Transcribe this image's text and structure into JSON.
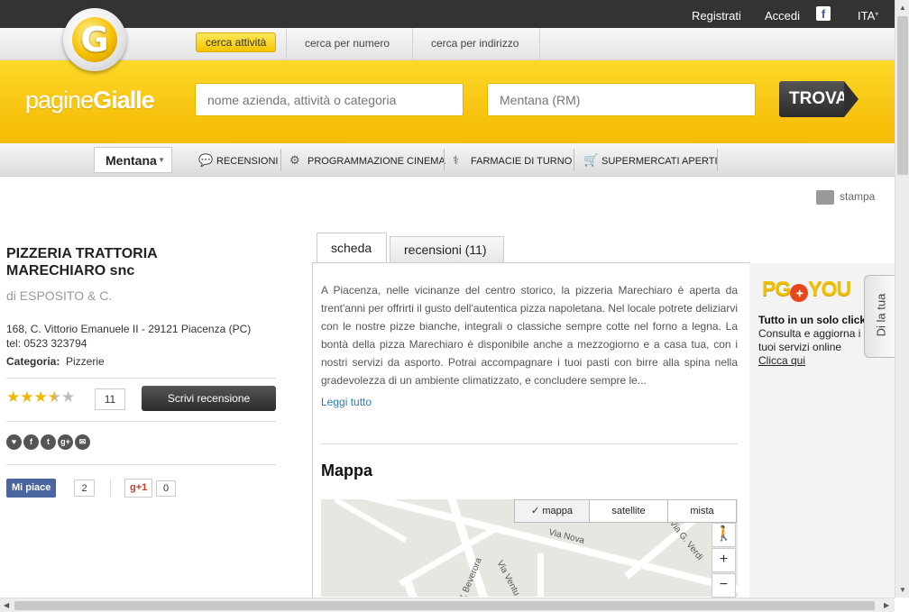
{
  "topbar": {
    "registrati": "Registrati",
    "accedi": "Accedi",
    "facebook_icon": "f",
    "lang": "ITA",
    "lang_caret": "▾"
  },
  "search_tabs": [
    "cerca attività",
    "cerca per numero",
    "cerca per indirizzo"
  ],
  "logo": {
    "g": "G",
    "pagine": "pagine",
    "gialle": "Gialle"
  },
  "search": {
    "what_placeholder": "nome azienda, attività o categoria",
    "where_placeholder": "Mentana (RM)",
    "button": "TROVA"
  },
  "catbar": {
    "city": "Mentana",
    "city_caret": "▼",
    "items": [
      "RECENSIONI",
      "PROGRAMMAZIONE CINEMA",
      "FARMACIE DI TURNO",
      "SUPERMERCATI APERTI"
    ],
    "icons": [
      "💬",
      "⚙",
      "⚕",
      "🛒"
    ]
  },
  "stampa": "stampa",
  "business": {
    "name_line1": "PIZZERIA TRATTORIA",
    "name_line2": "MARECHIARO snc",
    "owner": "di ESPOSITO & C.",
    "address": "168, C. Vittorio Emanuele II - 29121 Piacenza (PC)",
    "tel": "tel: 0523 323794",
    "category_label": "Categoria:",
    "category": "Pizzerie",
    "rating": 3.5,
    "stars_on": "★★★",
    "star_half": "★",
    "star_off": "★",
    "reviews_count": "11",
    "write_review": "Scrivi recensione",
    "share_icons": [
      "♥",
      "f",
      "t",
      "g+",
      "✉"
    ],
    "like_label": "Mi piace",
    "like_count": "2",
    "gplus_label": "g+1",
    "gplus_count": "0"
  },
  "tabs": {
    "scheda": "scheda",
    "recensioni": "recensioni (11)"
  },
  "description": "A Piacenza, nelle vicinanze del centro storico, la pizzeria Marechiaro è aperta da trent'anni per offrirti il gusto dell'autentica pizza napoletana. Nel locale potrete deliziarvi con le nostre pizze bianche, integrali o classiche sempre cotte nel forno a legna. La bontà della pizza Marechiaro è disponibile anche a mezzogiorno e a casa tua, con i nostri servizi da asporto. Potrai accompagnare i tuoi pasti con birre alla spina nella gradevolezza di un ambiente climatizzato, e concludere sempre le...",
  "leggi_tutto": "Leggi tutto",
  "map": {
    "title": "Mappa",
    "buttons": [
      "mappa",
      "satellite",
      "mista"
    ],
    "check": "✓",
    "zoom_in": "+",
    "zoom_out": "−",
    "pegman": "🚶",
    "streets": [
      "Via Nova",
      "Via G. Verdi",
      "Via Ventu",
      "V. Beverora"
    ]
  },
  "pgyou": {
    "pg": "PG",
    "plus": "+",
    "you": "YOU",
    "headline": "Tutto in un solo click",
    "line1": "Consulta e aggiorna i",
    "line2": "tuoi servizi online",
    "link": "Clicca qui"
  },
  "feedback_tab": "Di la tua"
}
